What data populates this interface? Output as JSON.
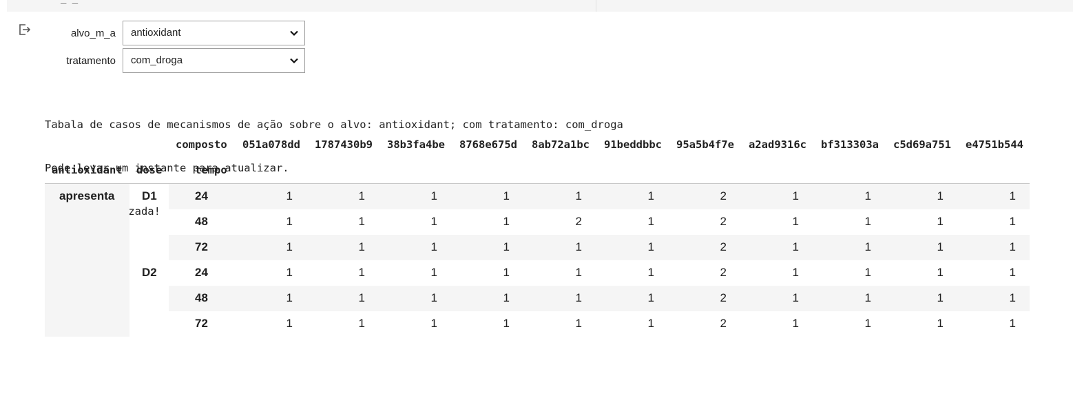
{
  "widgets": {
    "alvo": {
      "label": "alvo_m_a",
      "value": "antioxidant"
    },
    "tratamento": {
      "label": "tratamento",
      "value": "com_droga"
    }
  },
  "output_lines": [
    "Tabala de casos de mecanismos de ação sobre o alvo: antioxidant; com tratamento: com_droga",
    "Pode levar um instante para atualizar.",
    "Tabela atualizada!"
  ],
  "table": {
    "columns_name": "composto",
    "columns": [
      "051a078dd",
      "1787430b9",
      "38b3fa4be",
      "8768e675d",
      "8ab72a1bc",
      "91beddbbc",
      "95a5b4f7e",
      "a2ad9316c",
      "bf313303a",
      "c5d69a751",
      "e4751b544"
    ],
    "index_names": [
      "antioxidant",
      "dose",
      "tempo"
    ],
    "level0": "apresenta",
    "dose_groups": [
      "D1",
      "D2"
    ],
    "rows": [
      {
        "tempo": "24",
        "values": [
          1,
          1,
          1,
          1,
          1,
          1,
          2,
          1,
          1,
          1,
          1
        ]
      },
      {
        "tempo": "48",
        "values": [
          1,
          1,
          1,
          1,
          2,
          1,
          2,
          1,
          1,
          1,
          1
        ]
      },
      {
        "tempo": "72",
        "values": [
          1,
          1,
          1,
          1,
          1,
          1,
          2,
          1,
          1,
          1,
          1
        ]
      },
      {
        "tempo": "24",
        "values": [
          1,
          1,
          1,
          1,
          1,
          1,
          2,
          1,
          1,
          1,
          1
        ]
      },
      {
        "tempo": "48",
        "values": [
          1,
          1,
          1,
          1,
          1,
          1,
          2,
          1,
          1,
          1,
          1
        ]
      },
      {
        "tempo": "72",
        "values": [
          1,
          1,
          1,
          1,
          1,
          1,
          2,
          1,
          1,
          1,
          1
        ]
      }
    ]
  }
}
